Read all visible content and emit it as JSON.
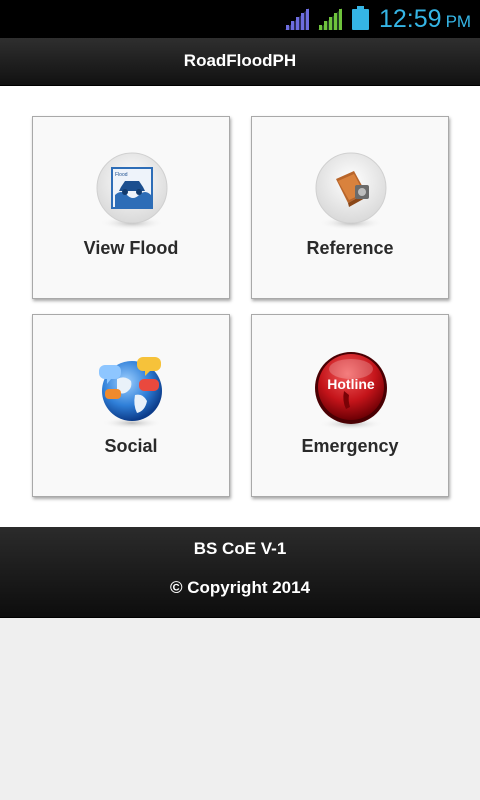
{
  "status_bar": {
    "time": "12:59",
    "ampm": "PM",
    "accent_color": "#35b5e5"
  },
  "action_bar": {
    "title": "RoadFloodPH"
  },
  "tiles": [
    {
      "label": "View Flood",
      "icon": "flood-map-icon",
      "icon_text": "Flood"
    },
    {
      "label": "Reference",
      "icon": "reference-book-icon"
    },
    {
      "label": "Social",
      "icon": "globe-chat-icon"
    },
    {
      "label": "Emergency",
      "icon": "hotline-phone-icon",
      "icon_text": "Hotline"
    }
  ],
  "footer": {
    "line1": "BS CoE V-1",
    "line2": "© Copyright 2014"
  }
}
